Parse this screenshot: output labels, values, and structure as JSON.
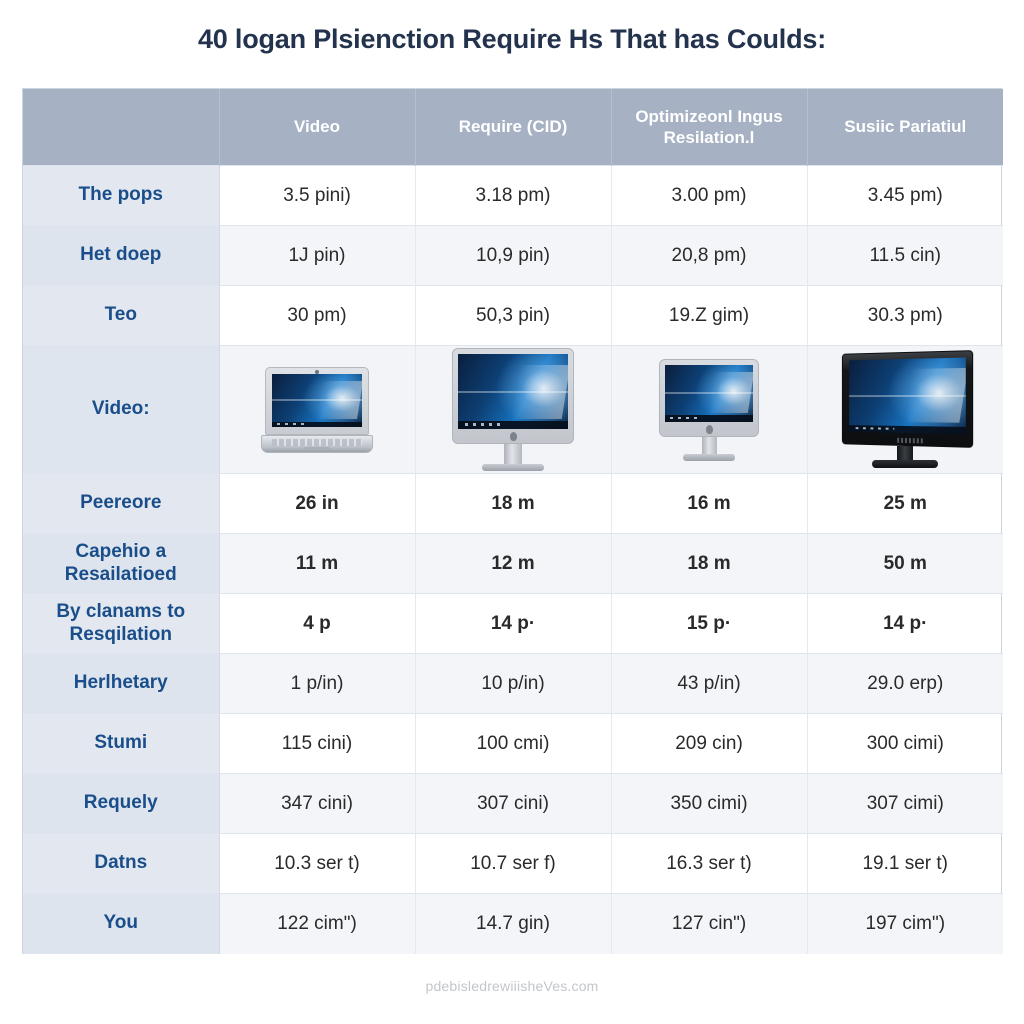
{
  "title": "40 logan Plsienction Require Hs That has Coulds:",
  "footer": "pdebisledrewiiisheVes.com",
  "colors": {
    "header_band": "#a6b1c4",
    "row_label_text": "#1a4e8a",
    "highlight_green": "#8d9c2c",
    "title_text": "#24334d",
    "row_label_bg": "#e3e8f0",
    "alt_row_bg": "#f3f5f9"
  },
  "table": {
    "corner_label": "",
    "columns": [
      {
        "label": "Video"
      },
      {
        "label": "Require (CID)"
      },
      {
        "label": "Optimizeonl Ingus Resilation.l"
      },
      {
        "label": "Susiic Pariatiul"
      }
    ],
    "rows": [
      {
        "label": "The pops",
        "type": "text",
        "cells": [
          "3.5 pini)",
          "3.18 pm)",
          "3.00 pm)",
          "3.45 pm)"
        ]
      },
      {
        "label": "Het doep",
        "type": "text",
        "cells": [
          "1J pin)",
          "10,9 pin)",
          "20,8 pm)",
          "11.5 cin)"
        ]
      },
      {
        "label": "Teo",
        "type": "text",
        "cells": [
          "30 pm)",
          "50,3 pin)",
          "19.Z gim)",
          "30.3 pm)"
        ]
      },
      {
        "label": "Video:",
        "type": "media",
        "cells": [
          "laptop-device-image",
          "all-in-one-desktop-image",
          "all-in-one-desktop-small-image",
          "black-monitor-image"
        ]
      },
      {
        "label": "Peereore",
        "type": "highlight",
        "cells": [
          "26 in",
          "18 m",
          "16 m",
          "25 m"
        ]
      },
      {
        "label": "Capehio a Resailatioed",
        "type": "highlight",
        "cells": [
          "11 m",
          "12 m",
          "18 m",
          "50 m"
        ]
      },
      {
        "label": "By clanams to Resqilation",
        "type": "highlight",
        "cells": [
          "4 p",
          "14 p·",
          "15 p·",
          "14 p·"
        ]
      },
      {
        "label": "Herlhetary",
        "type": "text",
        "cells": [
          "1 p/in)",
          "10 p/in)",
          "43 p/in)",
          "29.0 erp)"
        ]
      },
      {
        "label": "Stumi",
        "type": "text",
        "cells": [
          "115 cini)",
          "100 cmi)",
          "209 cin)",
          "300 cimi)"
        ]
      },
      {
        "label": "Requely",
        "type": "text",
        "cells": [
          "347 cini)",
          "307 cini)",
          "350 cimi)",
          "307 cimi)"
        ]
      },
      {
        "label": "Datns",
        "type": "text",
        "cells": [
          "10.3 ser t)",
          "10.7 ser f)",
          "16.3 ser t)",
          "19.1 ser t)"
        ]
      },
      {
        "label": "You",
        "type": "text",
        "cells": [
          "122 cimʺ)",
          "14.7 gin)",
          "127 cinʺ)",
          "197 cimʺ)"
        ]
      }
    ]
  }
}
